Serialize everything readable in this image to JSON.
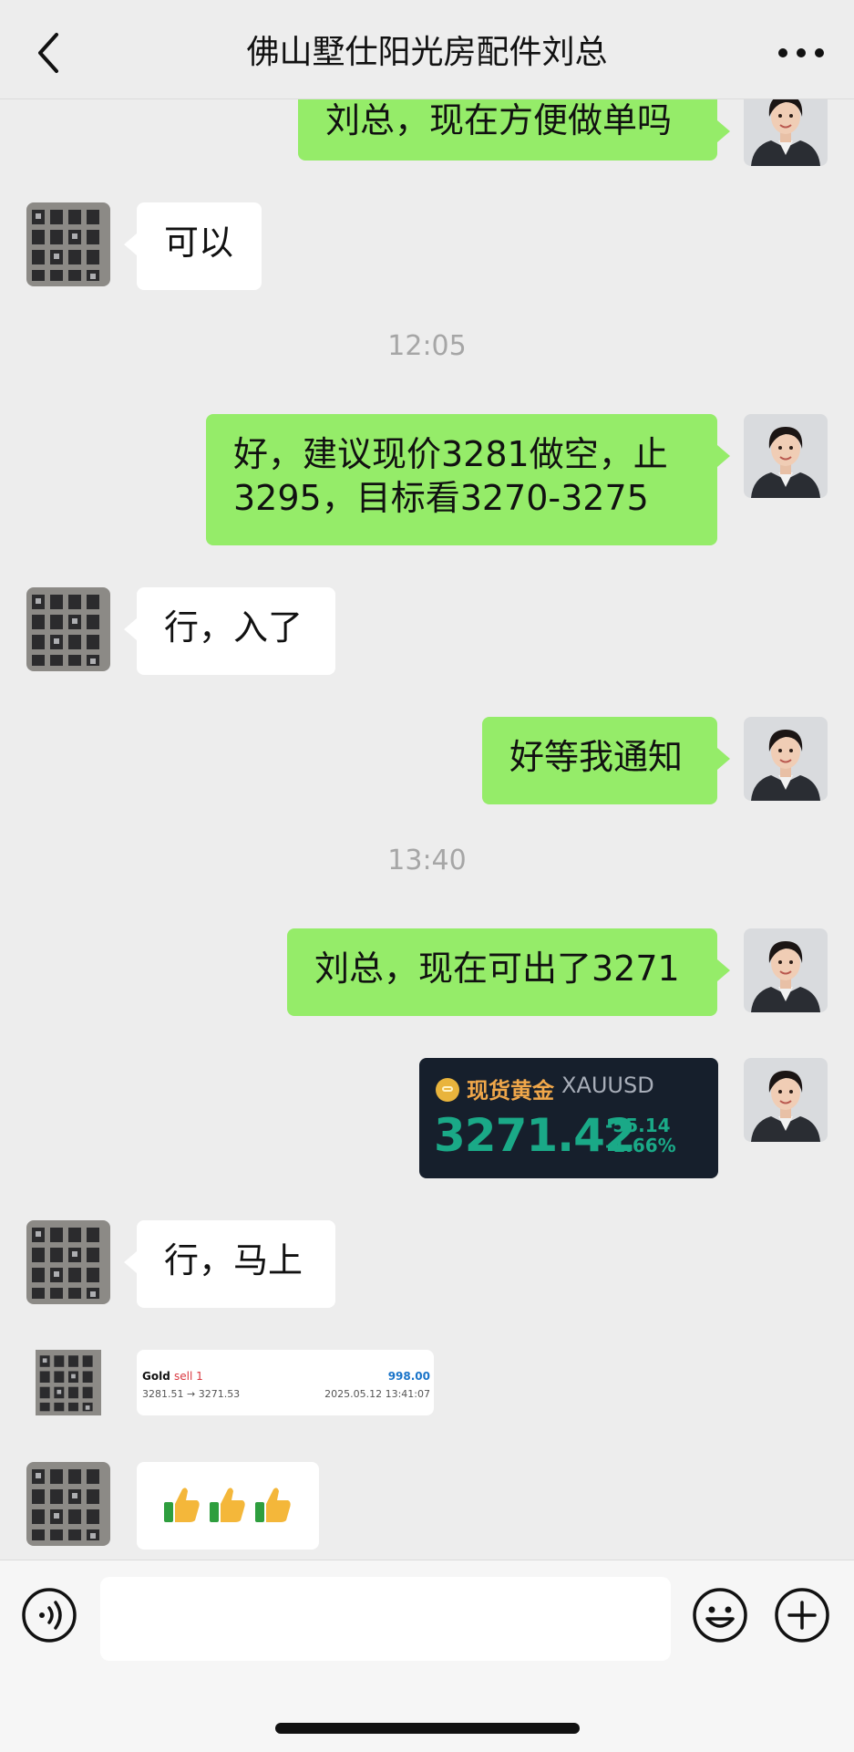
{
  "header": {
    "title": "佛山墅仕阳光房配件刘总",
    "back_icon": "chevron-left-icon",
    "more_icon": "more-dots-icon"
  },
  "messages": {
    "m1": "刘总，现在方便做单吗",
    "m2": "可以",
    "t1": "12:05",
    "m3": "好，建议现价3281做空，止3295，目标看3270-3275",
    "m4": "行，入了",
    "m5": "好等我通知",
    "t2": "13:40",
    "m6": "刘总，现在可出了3271",
    "m7": "行，马上"
  },
  "gold_card": {
    "name_cn": "现货黄金",
    "symbol": "XAUUSD",
    "price": "3271.42",
    "change": "-55.14",
    "change_pct": "-1.66%",
    "accent": "#1aa987"
  },
  "trade_card": {
    "instrument": "Gold",
    "side": "sell 1",
    "profit": "998.00",
    "prices": "3281.51 → 3271.53",
    "datetime": "2025.05.12 13:41:07"
  },
  "emoji_message": {
    "icon": "thumbs-up-icon",
    "count": 3
  },
  "input": {
    "value": "",
    "voice_icon": "voice-icon",
    "emoji_icon": "smile-icon",
    "plus_icon": "plus-icon"
  },
  "colors": {
    "my_bubble": "#95ec69",
    "their_bubble": "#ffffff",
    "background": "#ededed"
  }
}
